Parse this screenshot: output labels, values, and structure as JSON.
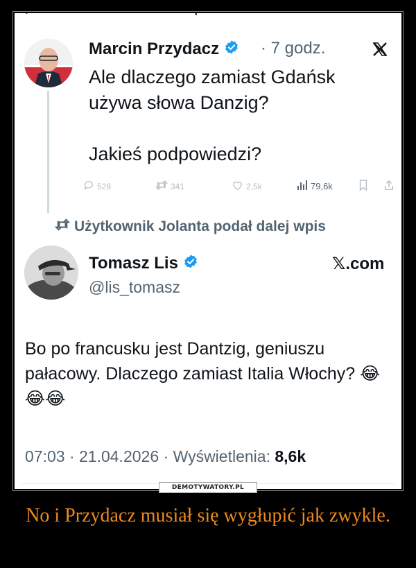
{
  "top_cut_text": "wpis",
  "tweet1": {
    "author": "Marcin Przydacz",
    "time": "· 7 godz.",
    "text": "Ale dlaczego zamiast Gdańsk\nużywa słowa Danzig?\n\nJakieś podpowiedzi?",
    "replies": "528",
    "retweets": "341",
    "likes": "2,5k",
    "views": "79,6k"
  },
  "retweet_notice": "Użytkownik Jolanta podał dalej wpis",
  "tweet2": {
    "author": "Tomasz Lis",
    "handle": "@lis_tomasz",
    "source": "𝕏.com",
    "text": "Bo po francusku jest Dantzig, geniuszu pałacowy. Dlaczego zamiast Italia Włochy?",
    "emoji": "😂😂😂",
    "datetime": "07:03 · 21.04.2026 · ",
    "views_label": "Wyświetlenia:",
    "views_value": "8,6k"
  },
  "watermark": "DEMOTYWATORY.PL",
  "caption": "No i Przydacz musiał się wygłupić jak zwykle.",
  "colors": {
    "verified": "#1d9bf0",
    "caption": "#f18a1c",
    "secondary_text": "#536471"
  },
  "icons": {
    "x_logo": "x-logo-icon",
    "verified": "verified-badge-icon",
    "retweet": "retweet-icon"
  }
}
